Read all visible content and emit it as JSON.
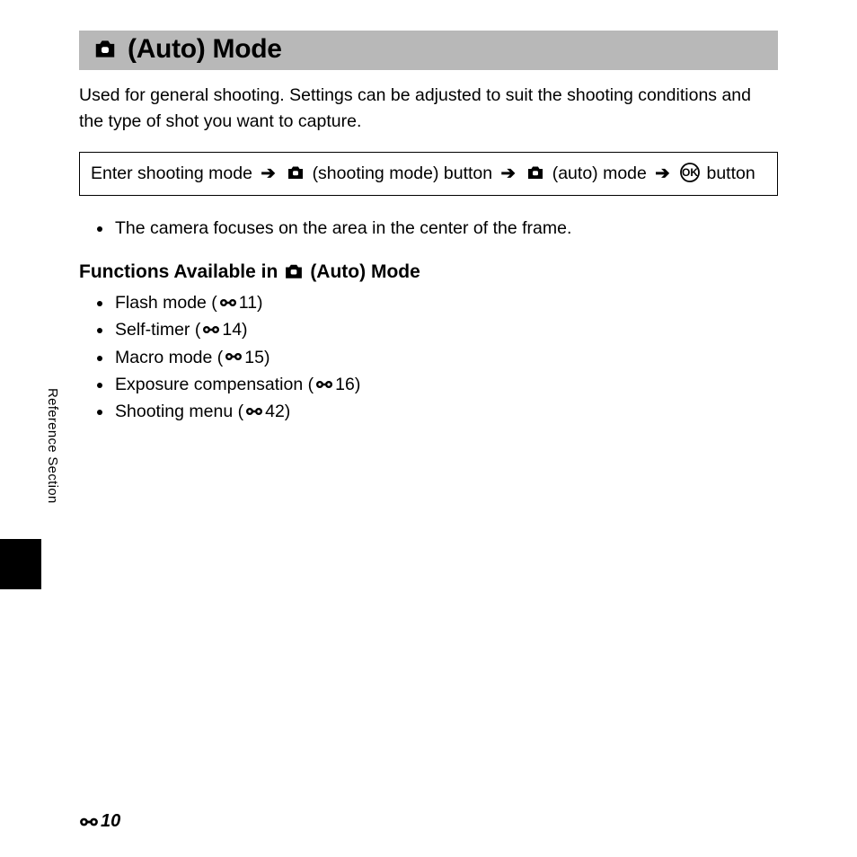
{
  "title": "(Auto) Mode",
  "intro": "Used for general shooting. Settings can be adjusted to suit the shooting conditions and the type of shot you want to capture.",
  "sequence": {
    "s1": "Enter shooting mode",
    "s2a": "(shooting mode) button",
    "s3a": "(auto) mode",
    "s4a": "button"
  },
  "bullet1": "The camera focuses on the area in the center of the frame.",
  "subhead_pre": "Functions Available in",
  "subhead_post": "(Auto) Mode",
  "functions": [
    {
      "label": "Flash mode (",
      "ref": "11)"
    },
    {
      "label": "Self-timer (",
      "ref": "14)"
    },
    {
      "label": "Macro mode (",
      "ref": "15)"
    },
    {
      "label": "Exposure compensation (",
      "ref": "16)"
    },
    {
      "label": "Shooting menu (",
      "ref": "42)"
    }
  ],
  "side_label": "Reference Section",
  "page_number": "10"
}
